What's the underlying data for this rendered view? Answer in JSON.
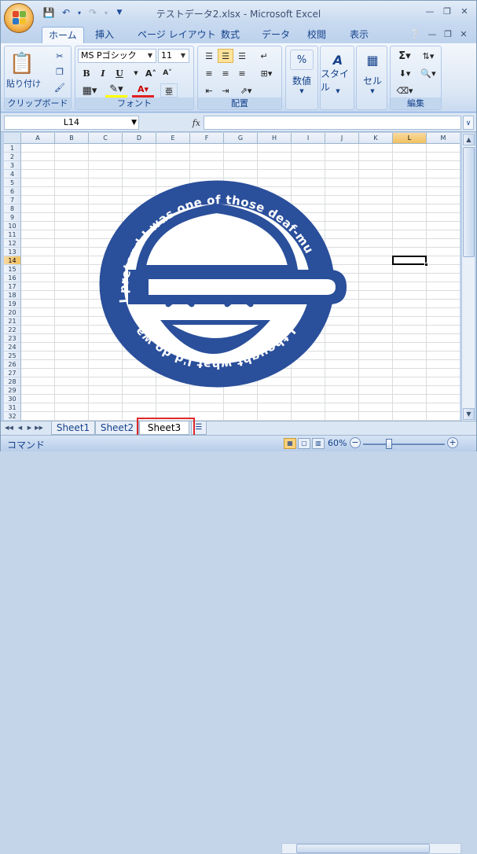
{
  "title": {
    "text": "テストデータ2.xlsx - Microsoft Excel"
  },
  "ribbon_tabs": [
    "ホーム",
    "挿入",
    "ページ レイアウト",
    "数式",
    "データ",
    "校閲",
    "表示"
  ],
  "clipboard": {
    "paste": "貼り付け",
    "group": "クリップボード"
  },
  "font": {
    "name": "MS Pゴシック",
    "size": "11",
    "group": "フォント",
    "bold": "B",
    "italic": "I",
    "underline": "U"
  },
  "alignment": {
    "group": "配置"
  },
  "number": {
    "label": "数値",
    "symbol": "%"
  },
  "style": {
    "label": "スタイル"
  },
  "cells": {
    "label": "セル"
  },
  "editing": {
    "group": "編集"
  },
  "formula_bar": {
    "name_box": "L14",
    "fx": "fx",
    "content": ""
  },
  "columns": [
    "A",
    "B",
    "C",
    "D",
    "E",
    "F",
    "G",
    "H",
    "I",
    "J",
    "K",
    "L",
    "M"
  ],
  "rows": [
    "1",
    "2",
    "3",
    "4",
    "5",
    "6",
    "7",
    "8",
    "9",
    "10",
    "11",
    "12",
    "13",
    "14",
    "15",
    "16",
    "17",
    "18",
    "19",
    "20",
    "21",
    "22",
    "23",
    "24",
    "25",
    "26",
    "27",
    "28",
    "29",
    "30",
    "31",
    "32"
  ],
  "selected": {
    "column": "L",
    "row": "14"
  },
  "emblem": {
    "ring_text": "I thought what I'd do was, I'd pretend I was one of those deaf-mutes",
    "top_arc": "I pretend I was one of those deaf-mutes",
    "bottom_arc": "I thought what I'd do was, I'd",
    "color": "#2a4f9b"
  },
  "sheets": [
    {
      "name": "Sheet1",
      "active": false
    },
    {
      "name": "Sheet2",
      "active": false
    },
    {
      "name": "Sheet3",
      "active": true
    }
  ],
  "status": {
    "mode": "コマンド",
    "zoom": "60%"
  },
  "colors": {
    "accent": "#15428b",
    "highlight": "#e0282b",
    "selection": "#f1c15f"
  }
}
